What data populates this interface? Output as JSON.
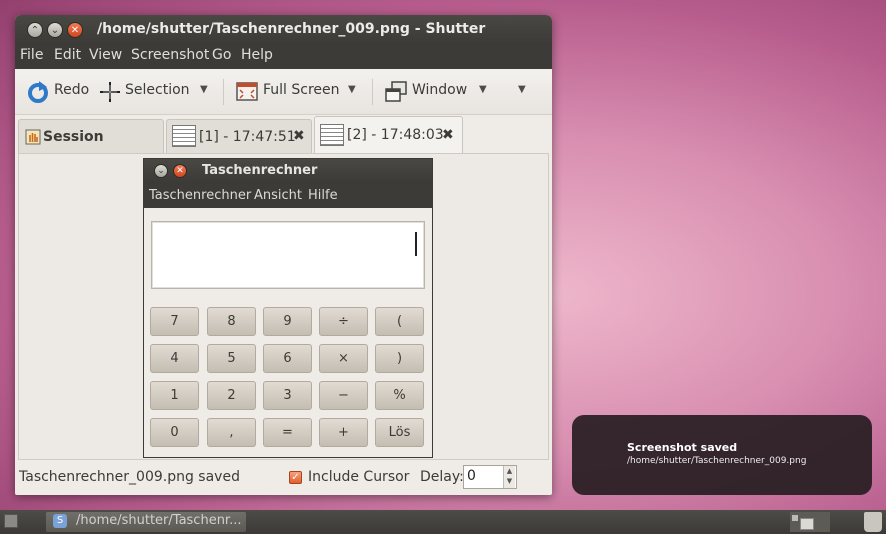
{
  "window": {
    "title": "/home/shutter/Taschenrechner_009.png - Shutter",
    "controls": {
      "minimize": "⌃",
      "maximize": "⌄",
      "close": "✕"
    }
  },
  "menubar": {
    "items": [
      "File",
      "Edit",
      "View",
      "Screenshot",
      "Go",
      "Help"
    ]
  },
  "toolbar": {
    "redo_label": "Redo",
    "selection_label": "Selection",
    "fullscreen_label": "Full Screen",
    "window_label": "Window",
    "arrow": "▼"
  },
  "tabs": {
    "session_label": "Session",
    "items": [
      {
        "label": "[1] - 17:47:51",
        "close": "✖"
      },
      {
        "label": "[2] - 17:48:03",
        "close": "✖"
      }
    ]
  },
  "calculator": {
    "title": "Taschenrechner",
    "menu": [
      "Taschenrechner",
      "Ansicht",
      "Hilfe"
    ],
    "keys": [
      [
        "7",
        "8",
        "9",
        "÷",
        "("
      ],
      [
        "4",
        "5",
        "6",
        "×",
        ")"
      ],
      [
        "1",
        "2",
        "3",
        "−",
        "%"
      ],
      [
        "0",
        ",",
        "=",
        "+",
        "Lös"
      ]
    ]
  },
  "statusbar": {
    "message": "Taschenrechner_009.png saved",
    "include_cursor_label": "Include Cursor",
    "include_cursor_checked": true,
    "check_mark": "✓",
    "delay_label": "Delay:",
    "delay_value": "0",
    "spin_up": "▲",
    "spin_down": "▼"
  },
  "notification": {
    "heading": "Screenshot saved",
    "body": "/home/shutter/Taschenrechner_009.png"
  },
  "panel": {
    "task_label": "/home/shutter/Taschenr...",
    "task_icon": "S"
  },
  "colors": {
    "accent": "#e35f2c",
    "titlebar": "#3c3b37",
    "window_bg": "#efebe6"
  }
}
